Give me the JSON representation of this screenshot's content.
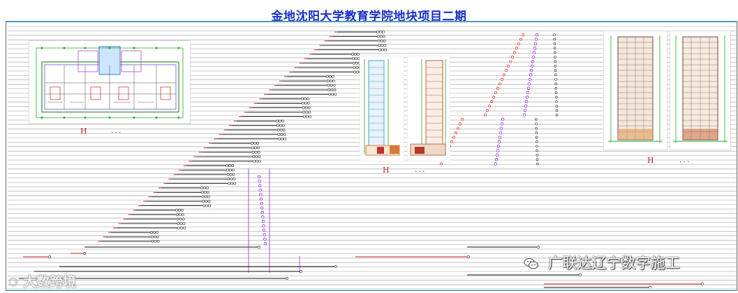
{
  "title": "金地沈阳大学教育学院地块项目二期",
  "labels": {
    "plan_mark": "H",
    "plan_dots": "...",
    "tower_mark": "H",
    "tower_dots": "...",
    "elev_mark": "H",
    "elev_dots": "..."
  },
  "watermarks": {
    "left": "大数跨境",
    "right": "广联达辽宁数字施工"
  },
  "colors": {
    "title": "#1a2fc8",
    "line": "#000000",
    "accent_red": "#d42020",
    "accent_purple": "#8a2be2",
    "frame_top": "#4a9cb8"
  },
  "icons": [
    "wechat-icon",
    "weibo-icon"
  ]
}
